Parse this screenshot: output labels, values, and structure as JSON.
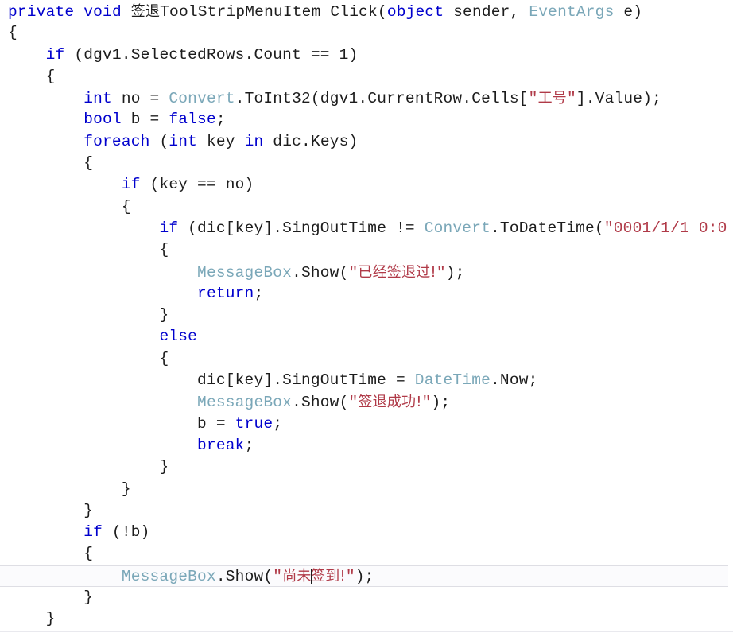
{
  "editor": {
    "language": "csharp",
    "current_line_index": 25,
    "caret_line_index": 25,
    "colors": {
      "background": "#ffffff",
      "text": "#202020",
      "keyword": "#0000cd",
      "type": "#7aa7b8",
      "string": "#b03a48",
      "current_line_background": "#fbfbfd",
      "current_line_border": "#dedee4",
      "caret": "#1a1a1a"
    },
    "lines": [
      {
        "index": 0,
        "indent": 0,
        "tokens": [
          {
            "t": "kw",
            "v": "private"
          },
          {
            "t": "pln",
            "v": " "
          },
          {
            "t": "kw",
            "v": "void"
          },
          {
            "t": "pln",
            "v": " "
          },
          {
            "t": "cjk",
            "v": "签退"
          },
          {
            "t": "pln",
            "v": "ToolStripMenuItem_Click("
          },
          {
            "t": "kw",
            "v": "object"
          },
          {
            "t": "pln",
            "v": " sender, "
          },
          {
            "t": "typ",
            "v": "EventArgs"
          },
          {
            "t": "pln",
            "v": " e)"
          }
        ]
      },
      {
        "index": 1,
        "indent": 0,
        "tokens": [
          {
            "t": "pln",
            "v": "{"
          }
        ]
      },
      {
        "index": 2,
        "indent": 1,
        "tokens": [
          {
            "t": "kw",
            "v": "if"
          },
          {
            "t": "pln",
            "v": " (dgv1.SelectedRows.Count == "
          },
          {
            "t": "num",
            "v": "1"
          },
          {
            "t": "pln",
            "v": ")"
          }
        ]
      },
      {
        "index": 3,
        "indent": 1,
        "tokens": [
          {
            "t": "pln",
            "v": "{"
          }
        ]
      },
      {
        "index": 4,
        "indent": 2,
        "tokens": [
          {
            "t": "kw",
            "v": "int"
          },
          {
            "t": "pln",
            "v": " no = "
          },
          {
            "t": "typ",
            "v": "Convert"
          },
          {
            "t": "pln",
            "v": ".ToInt32(dgv1.CurrentRow.Cells["
          },
          {
            "t": "str",
            "v": "\""
          },
          {
            "t": "strcjk",
            "v": "工号"
          },
          {
            "t": "str",
            "v": "\""
          },
          {
            "t": "pln",
            "v": "].Value);"
          }
        ]
      },
      {
        "index": 5,
        "indent": 2,
        "tokens": [
          {
            "t": "kw",
            "v": "bool"
          },
          {
            "t": "pln",
            "v": " b = "
          },
          {
            "t": "kw",
            "v": "false"
          },
          {
            "t": "pln",
            "v": ";"
          }
        ]
      },
      {
        "index": 6,
        "indent": 2,
        "tokens": [
          {
            "t": "kw",
            "v": "foreach"
          },
          {
            "t": "pln",
            "v": " ("
          },
          {
            "t": "kw",
            "v": "int"
          },
          {
            "t": "pln",
            "v": " key "
          },
          {
            "t": "kw",
            "v": "in"
          },
          {
            "t": "pln",
            "v": " dic.Keys)"
          }
        ]
      },
      {
        "index": 7,
        "indent": 2,
        "tokens": [
          {
            "t": "pln",
            "v": "{"
          }
        ]
      },
      {
        "index": 8,
        "indent": 3,
        "tokens": [
          {
            "t": "kw",
            "v": "if"
          },
          {
            "t": "pln",
            "v": " (key == no)"
          }
        ]
      },
      {
        "index": 9,
        "indent": 3,
        "tokens": [
          {
            "t": "pln",
            "v": "{"
          }
        ]
      },
      {
        "index": 10,
        "indent": 4,
        "tokens": [
          {
            "t": "kw",
            "v": "if"
          },
          {
            "t": "pln",
            "v": " (dic[key].SingOutTime != "
          },
          {
            "t": "typ",
            "v": "Convert"
          },
          {
            "t": "pln",
            "v": ".ToDateTime("
          },
          {
            "t": "str",
            "v": "\"0001/1/1 0:0"
          }
        ]
      },
      {
        "index": 11,
        "indent": 4,
        "tokens": [
          {
            "t": "pln",
            "v": "{"
          }
        ]
      },
      {
        "index": 12,
        "indent": 5,
        "tokens": [
          {
            "t": "typ",
            "v": "MessageBox"
          },
          {
            "t": "pln",
            "v": ".Show("
          },
          {
            "t": "str",
            "v": "\""
          },
          {
            "t": "strcjk",
            "v": "已经签退过!"
          },
          {
            "t": "str",
            "v": "\""
          },
          {
            "t": "pln",
            "v": ");"
          }
        ]
      },
      {
        "index": 13,
        "indent": 5,
        "tokens": [
          {
            "t": "kw",
            "v": "return"
          },
          {
            "t": "pln",
            "v": ";"
          }
        ]
      },
      {
        "index": 14,
        "indent": 4,
        "tokens": [
          {
            "t": "pln",
            "v": "}"
          }
        ]
      },
      {
        "index": 15,
        "indent": 4,
        "tokens": [
          {
            "t": "kw",
            "v": "else"
          }
        ]
      },
      {
        "index": 16,
        "indent": 4,
        "tokens": [
          {
            "t": "pln",
            "v": "{"
          }
        ]
      },
      {
        "index": 17,
        "indent": 5,
        "tokens": [
          {
            "t": "pln",
            "v": "dic[key].SingOutTime = "
          },
          {
            "t": "typ",
            "v": "DateTime"
          },
          {
            "t": "pln",
            "v": ".Now;"
          }
        ]
      },
      {
        "index": 18,
        "indent": 5,
        "tokens": [
          {
            "t": "typ",
            "v": "MessageBox"
          },
          {
            "t": "pln",
            "v": ".Show("
          },
          {
            "t": "str",
            "v": "\""
          },
          {
            "t": "strcjk",
            "v": "签退成功!"
          },
          {
            "t": "str",
            "v": "\""
          },
          {
            "t": "pln",
            "v": ");"
          }
        ]
      },
      {
        "index": 19,
        "indent": 5,
        "tokens": [
          {
            "t": "pln",
            "v": "b = "
          },
          {
            "t": "kw",
            "v": "true"
          },
          {
            "t": "pln",
            "v": ";"
          }
        ]
      },
      {
        "index": 20,
        "indent": 5,
        "tokens": [
          {
            "t": "kw",
            "v": "break"
          },
          {
            "t": "pln",
            "v": ";"
          }
        ]
      },
      {
        "index": 21,
        "indent": 4,
        "tokens": [
          {
            "t": "pln",
            "v": "}"
          }
        ]
      },
      {
        "index": 22,
        "indent": 3,
        "tokens": [
          {
            "t": "pln",
            "v": "}"
          }
        ]
      },
      {
        "index": 23,
        "indent": 2,
        "tokens": [
          {
            "t": "pln",
            "v": "}"
          }
        ]
      },
      {
        "index": 24,
        "indent": 2,
        "tokens": [
          {
            "t": "kw",
            "v": "if"
          },
          {
            "t": "pln",
            "v": " (!b)"
          }
        ]
      },
      {
        "index": 25,
        "indent": 2,
        "tokens": [
          {
            "t": "pln",
            "v": "{"
          }
        ]
      },
      {
        "index": 26,
        "indent": 3,
        "current": true,
        "tokens": [
          {
            "t": "typ",
            "v": "MessageBox"
          },
          {
            "t": "pln",
            "v": ".Show("
          },
          {
            "t": "str",
            "v": "\""
          },
          {
            "t": "strcjk",
            "v": "尚未"
          },
          {
            "t": "caret",
            "v": ""
          },
          {
            "t": "strcjk",
            "v": "签到!"
          },
          {
            "t": "str",
            "v": "\""
          },
          {
            "t": "pln",
            "v": ");"
          }
        ]
      },
      {
        "index": 27,
        "indent": 2,
        "tokens": [
          {
            "t": "pln",
            "v": "}"
          }
        ]
      },
      {
        "index": 28,
        "indent": 1,
        "tokens": [
          {
            "t": "pln",
            "v": "}"
          }
        ]
      }
    ]
  }
}
